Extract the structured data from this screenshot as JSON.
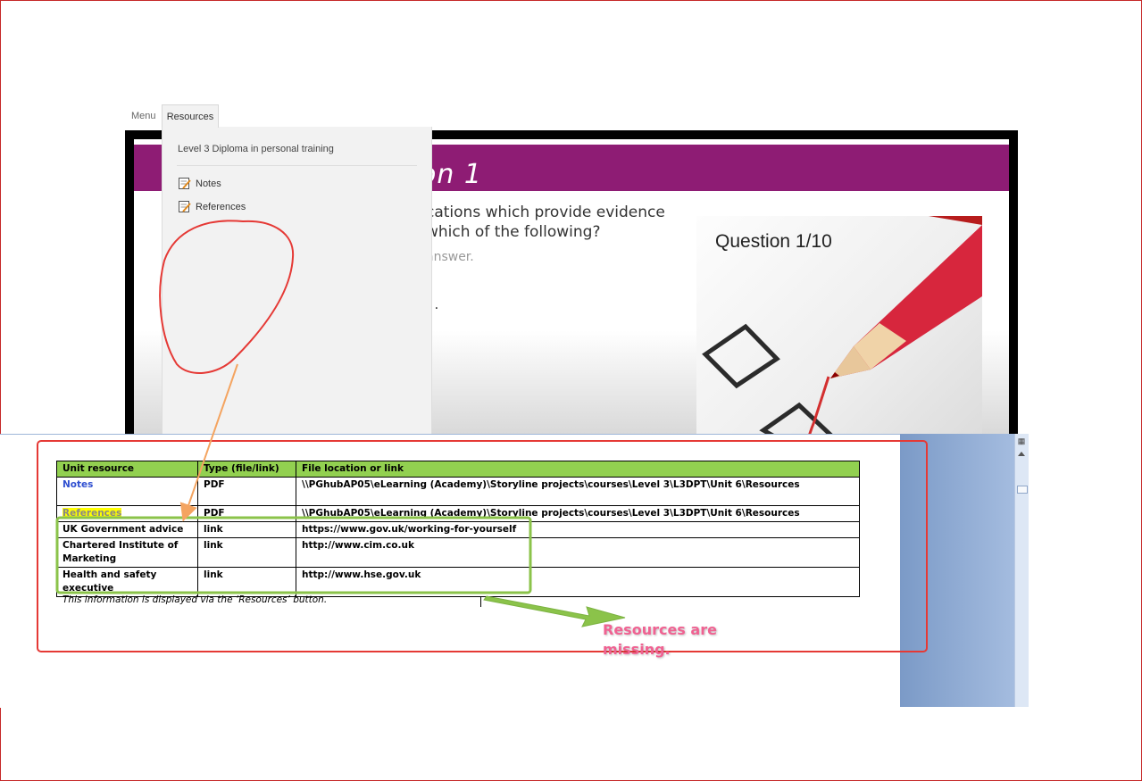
{
  "player": {
    "tabs": {
      "menu": "Menu",
      "resources": "Resources"
    },
    "panel": {
      "title": "Level 3 Diploma in personal training",
      "items": [
        {
          "label": "Notes",
          "icon": "note-icon"
        },
        {
          "label": "References",
          "icon": "note-icon"
        }
      ]
    }
  },
  "slide": {
    "title_fragment": "on 1",
    "question_line1": "cations which provide evidence",
    "question_line2": "which of the following?",
    "hint": "answer.",
    "dots": ". .",
    "counter": "Question 1/10",
    "band_color": "#8e1c74"
  },
  "document": {
    "headers": [
      "Unit resource",
      "Type (file/link)",
      "File location or link"
    ],
    "rows": [
      [
        "Notes",
        "PDF",
        "\\\\PGhubAP05\\eLearning (Academy)\\Storyline projects\\courses\\Level 3\\L3DPT\\Unit 6\\Resources"
      ],
      [
        "References",
        "PDF",
        "\\\\PGhubAP05\\eLearning (Academy)\\Storyline projects\\courses\\Level 3\\L3DPT\\Unit 6\\Resources"
      ],
      [
        "UK Government advice",
        "link",
        "https://www.gov.uk/working-for-yourself"
      ],
      [
        "Chartered Institute of Marketing",
        "link",
        "http://www.cim.co.uk"
      ],
      [
        "Health and safety executive",
        "link",
        "http://www.hse.gov.uk"
      ]
    ],
    "caption": "This information is displayed via the ‘Resources’ button.",
    "header_color": "#92d050"
  },
  "annotation": {
    "line1": "Resources are",
    "line2": "missing.",
    "colors": {
      "red": "#e53935",
      "green": "#8bc34a",
      "orange": "#f4a460",
      "pink": "#f06292"
    }
  }
}
